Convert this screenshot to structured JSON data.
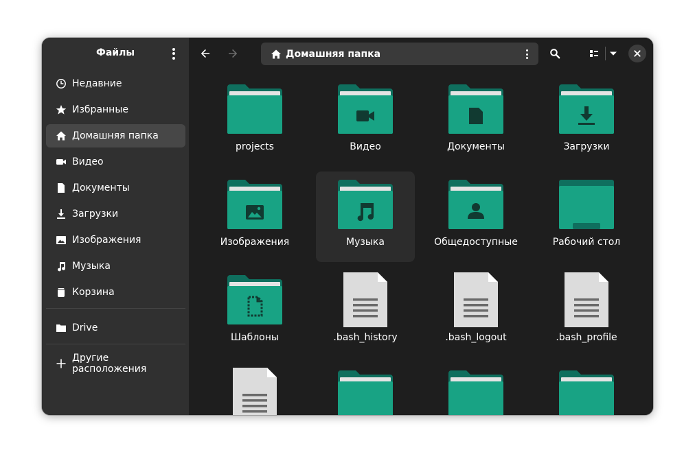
{
  "sidebar": {
    "title": "Файлы",
    "items": [
      {
        "label": "Недавние",
        "icon": "clock-icon"
      },
      {
        "label": "Избранные",
        "icon": "star-icon"
      },
      {
        "label": "Домашняя папка",
        "icon": "home-icon",
        "active": true
      },
      {
        "label": "Видео",
        "icon": "video-camera-icon"
      },
      {
        "label": "Документы",
        "icon": "document-icon"
      },
      {
        "label": "Загрузки",
        "icon": "download-icon"
      },
      {
        "label": "Изображения",
        "icon": "image-icon"
      },
      {
        "label": "Музыка",
        "icon": "music-note-icon"
      },
      {
        "label": "Корзина",
        "icon": "trash-icon"
      }
    ],
    "drives": [
      {
        "label": "Drive",
        "icon": "folder-icon"
      }
    ],
    "other": {
      "label": "Другие расположения",
      "icon": "plus-icon"
    }
  },
  "header": {
    "path": "Домашняя папка",
    "back_icon": "arrow-left-icon",
    "forward_icon": "arrow-right-icon",
    "search_icon": "search-icon",
    "view_icon": "list-view-icon",
    "view_menu_icon": "chevron-down-icon",
    "close_icon": "close-icon"
  },
  "files": [
    {
      "name": "projects",
      "type": "folder",
      "emblem": "none"
    },
    {
      "name": "Видео",
      "type": "folder",
      "emblem": "video"
    },
    {
      "name": "Документы",
      "type": "folder",
      "emblem": "document"
    },
    {
      "name": "Загрузки",
      "type": "folder",
      "emblem": "download"
    },
    {
      "name": "Изображения",
      "type": "folder",
      "emblem": "image"
    },
    {
      "name": "Музыка",
      "type": "folder",
      "emblem": "music",
      "selected": true
    },
    {
      "name": "Общедоступные",
      "type": "folder",
      "emblem": "person"
    },
    {
      "name": "Рабочий стол",
      "type": "desktop",
      "emblem": "desktop"
    },
    {
      "name": "Шаблоны",
      "type": "folder",
      "emblem": "template"
    },
    {
      "name": ".bash_history",
      "type": "text-file",
      "emblem": "text"
    },
    {
      "name": ".bash_logout",
      "type": "text-file",
      "emblem": "text"
    },
    {
      "name": ".bash_profile",
      "type": "text-file",
      "emblem": "text"
    },
    {
      "name": "",
      "type": "text-file",
      "emblem": "text"
    },
    {
      "name": "",
      "type": "folder",
      "emblem": "none"
    },
    {
      "name": "",
      "type": "folder",
      "emblem": "none"
    },
    {
      "name": "",
      "type": "folder",
      "emblem": "none"
    }
  ],
  "colors": {
    "folder_back": "#0f6f5e",
    "folder_front": "#18a384",
    "folder_paper": "#e4e4e4",
    "emblem": "#113a31",
    "file_page": "#dcdcdc",
    "file_fold": "#ffffff",
    "file_lines": "#6a6a6a"
  }
}
